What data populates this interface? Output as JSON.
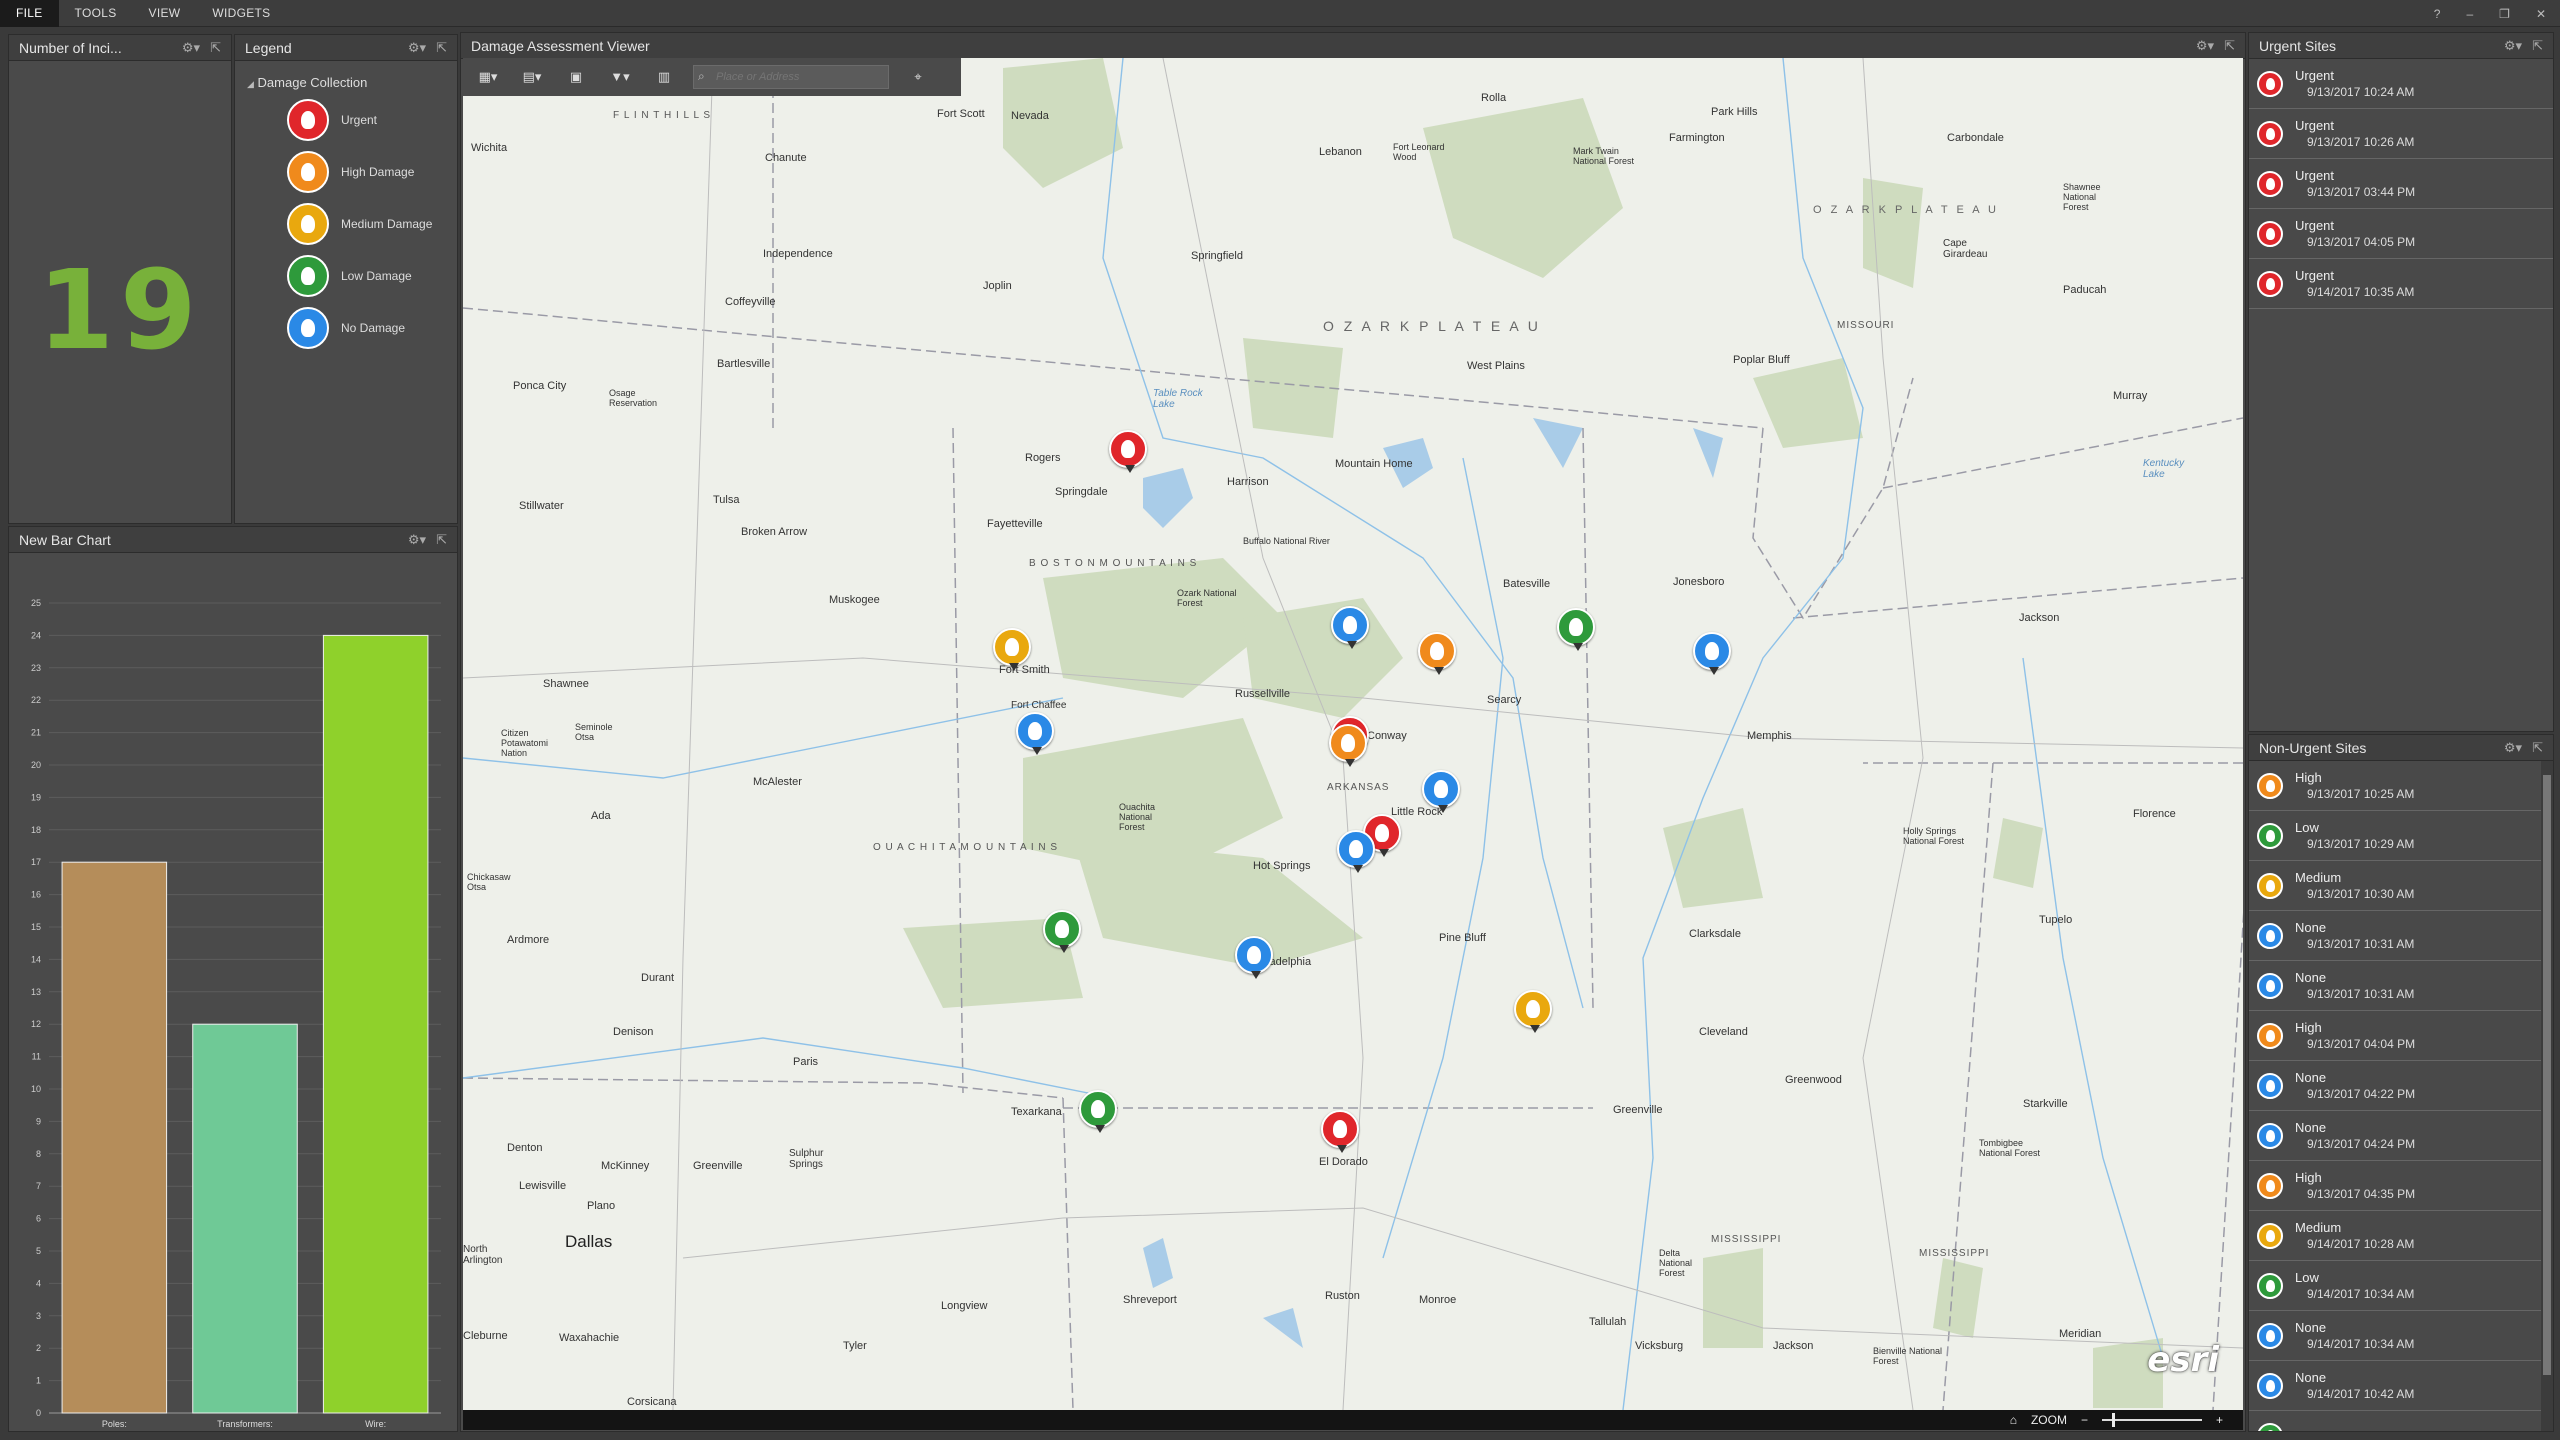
{
  "menubar": {
    "items": [
      "FILE",
      "TOOLS",
      "VIEW",
      "WIDGETS"
    ],
    "right_icons": [
      "?",
      "–",
      "❐",
      "✕"
    ]
  },
  "counter_panel": {
    "title": "Number of Inci...",
    "value": "19"
  },
  "legend_panel": {
    "title": "Legend",
    "group": "Damage Collection",
    "items": [
      {
        "label": "Urgent",
        "color": "#e0262b"
      },
      {
        "label": "High Damage",
        "color": "#f08a1c"
      },
      {
        "label": "Medium Damage",
        "color": "#e9a80e"
      },
      {
        "label": "Low Damage",
        "color": "#2e9a3b"
      },
      {
        "label": "No Damage",
        "color": "#2a89e6"
      }
    ]
  },
  "chart_panel": {
    "title": "New Bar Chart",
    "chart_data": {
      "type": "bar",
      "categories": [
        "Poles:",
        "Transformers:",
        "Wire:"
      ],
      "values": [
        17,
        12,
        24
      ],
      "colors": [
        "#b58d5a",
        "#6fc996",
        "#8fd12b"
      ],
      "ylim": [
        0,
        25
      ],
      "yticks": [
        0,
        1,
        2,
        3,
        4,
        5,
        6,
        7,
        8,
        9,
        10,
        11,
        12,
        13,
        14,
        15,
        16,
        17,
        18,
        19,
        20,
        21,
        22,
        23,
        24,
        25
      ],
      "grid": true
    }
  },
  "map_panel": {
    "title": "Damage Assessment Viewer",
    "search_placeholder": "Place or Address",
    "zoom_label": "ZOOM",
    "attribution": "esri",
    "labels": {
      "flint_hills": "F L I N T   H I L L S",
      "fort_scott": "Fort Scott",
      "nevada": "Nevada",
      "rolla": "Rolla",
      "park_hills": "Park Hills",
      "farmington": "Farmington",
      "carbondale": "Carbondale",
      "wichita": "Wichita",
      "chanute": "Chanute",
      "lebanon": "Lebanon",
      "fort_leonard_wood": "Fort Leonard Wood",
      "mark_twain": "Mark Twain National Forest",
      "ozark_plateau_ne": "O Z A R K   P L A T E A U",
      "shawnee_nf": "Shawnee National Forest",
      "independence": "Independence",
      "springfield": "Springfield",
      "cape_girardeau": "Cape Girardeau",
      "paducah": "Paducah",
      "coffeyville": "Coffeyville",
      "joplin": "Joplin",
      "ozark_plateau": "O Z A R K   P L A T E A U",
      "missouri": "MISSOURI",
      "west_plains": "West Plains",
      "poplar_bluff": "Poplar Bluff",
      "bartlesville": "Bartlesville",
      "ponca_city": "Ponca City",
      "osage_res": "Osage Reservation",
      "table_rock": "Table Rock Lake",
      "murray": "Murray",
      "rogers": "Rogers",
      "springdale": "Springdale",
      "harrison": "Harrison",
      "mountain_home": "Mountain Home",
      "kentucky_lake": "Kentucky Lake",
      "stillwater": "Stillwater",
      "tulsa": "Tulsa",
      "broken_arrow": "Broken Arrow",
      "fayetteville": "Fayetteville",
      "buffalo_river": "Buffalo National River",
      "jonesboro": "Jonesboro",
      "boston_mtns": "B O S T O N   M O U N T A I N S",
      "batesville": "Batesville",
      "muskogee": "Muskogee",
      "ozark_nf": "Ozark National Forest",
      "jackson_tn": "Jackson",
      "fort_smith": "Fort Smith",
      "russellville": "Russellville",
      "fort_chaffee": "Fort Chaffee",
      "searcy": "Searcy",
      "shawnee": "Shawnee",
      "seminole": "Seminole Otsa",
      "citizen_potawatomi": "Citizen Potawatomi Nation",
      "mcalester": "McAlester",
      "memphis": "Memphis",
      "conway": "Conway",
      "arkansas": "ARKANSAS",
      "little_rock": "Little Rock",
      "ouachita_nf": "Ouachita National Forest",
      "ada": "Ada",
      "ouachita_mtns": "O U A C H I T A   M O U N T A I N S",
      "hot_springs": "Hot Springs",
      "holly_springs": "Holly Springs National Forest",
      "florence": "Florence",
      "chickasaw": "Chickasaw Otsa",
      "ardmore": "Ardmore",
      "pine_bluff": "Pine Bluff",
      "clarksdale": "Clarksdale",
      "tupelo": "Tupelo",
      "durant": "Durant",
      "arkadelphia": "Arkadelphia",
      "denison": "Denison",
      "paris": "Paris",
      "cleveland": "Cleveland",
      "greenwood": "Greenwood",
      "starkville": "Starkville",
      "texarkana": "Texarkana",
      "greenville_ms": "Greenville",
      "denton": "Denton",
      "mckinney": "McKinney",
      "greenville_tx": "Greenville",
      "sulphur_springs": "Sulphur Springs",
      "el_dorado": "El Dorado",
      "tombigbee": "Tombigbee National Forest",
      "lewisville": "Lewisville",
      "plano": "Plano",
      "dallas": "Dallas",
      "mississippi": "MISSISSIPPI",
      "north_arlington": "North Arlington",
      "delta_nf": "Delta National Forest",
      "longview": "Longview",
      "shreveport": "Shreveport",
      "ruston": "Ruston",
      "monroe": "Monroe",
      "waxahachie": "Waxahachie",
      "cleburne": "Cleburne",
      "tyler": "Tyler",
      "tallulah": "Tallulah",
      "vicksburg": "Vicksburg",
      "jackson_ms": "Jackson",
      "meridian": "Meridian",
      "bienville": "Bienville National Forest",
      "corsicana": "Corsicana"
    },
    "pins": [
      {
        "color": "#e0262b"
      },
      {
        "color": "#e9a80e"
      },
      {
        "color": "#2a89e6"
      },
      {
        "color": "#2a89e6"
      },
      {
        "color": "#f08a1c"
      },
      {
        "color": "#2e9a3b"
      },
      {
        "color": "#2a89e6"
      },
      {
        "color": "#e0262b"
      },
      {
        "color": "#f08a1c"
      },
      {
        "color": "#2a89e6"
      },
      {
        "color": "#e0262b"
      },
      {
        "color": "#2a89e6"
      },
      {
        "color": "#2e9a3b"
      },
      {
        "color": "#2a89e6"
      },
      {
        "color": "#e9a80e"
      },
      {
        "color": "#2e9a3b"
      },
      {
        "color": "#e0262b"
      }
    ]
  },
  "urgent_panel": {
    "title": "Urgent Sites",
    "rows": [
      {
        "name": "Urgent",
        "time": "9/13/2017 10:24 AM",
        "color": "#e0262b"
      },
      {
        "name": "Urgent",
        "time": "9/13/2017 10:26 AM",
        "color": "#e0262b"
      },
      {
        "name": "Urgent",
        "time": "9/13/2017 03:44 PM",
        "color": "#e0262b"
      },
      {
        "name": "Urgent",
        "time": "9/13/2017 04:05 PM",
        "color": "#e0262b"
      },
      {
        "name": "Urgent",
        "time": "9/14/2017 10:35 AM",
        "color": "#e0262b"
      }
    ]
  },
  "nonurgent_panel": {
    "title": "Non-Urgent Sites",
    "rows": [
      {
        "name": "High",
        "time": "9/13/2017 10:25 AM",
        "color": "#f08a1c"
      },
      {
        "name": "Low",
        "time": "9/13/2017 10:29 AM",
        "color": "#2e9a3b"
      },
      {
        "name": "Medium",
        "time": "9/13/2017 10:30 AM",
        "color": "#e9a80e"
      },
      {
        "name": "None",
        "time": "9/13/2017 10:31 AM",
        "color": "#2a89e6"
      },
      {
        "name": "None",
        "time": "9/13/2017 10:31 AM",
        "color": "#2a89e6"
      },
      {
        "name": "High",
        "time": "9/13/2017 04:04 PM",
        "color": "#f08a1c"
      },
      {
        "name": "None",
        "time": "9/13/2017 04:22 PM",
        "color": "#2a89e6"
      },
      {
        "name": "None",
        "time": "9/13/2017 04:24 PM",
        "color": "#2a89e6"
      },
      {
        "name": "High",
        "time": "9/13/2017 04:35 PM",
        "color": "#f08a1c"
      },
      {
        "name": "Medium",
        "time": "9/14/2017 10:28 AM",
        "color": "#e9a80e"
      },
      {
        "name": "Low",
        "time": "9/14/2017 10:34 AM",
        "color": "#2e9a3b"
      },
      {
        "name": "None",
        "time": "9/14/2017 10:34 AM",
        "color": "#2a89e6"
      },
      {
        "name": "None",
        "time": "9/14/2017 10:42 AM",
        "color": "#2a89e6"
      },
      {
        "name": "Low",
        "time": "",
        "color": "#2e9a3b"
      }
    ]
  }
}
